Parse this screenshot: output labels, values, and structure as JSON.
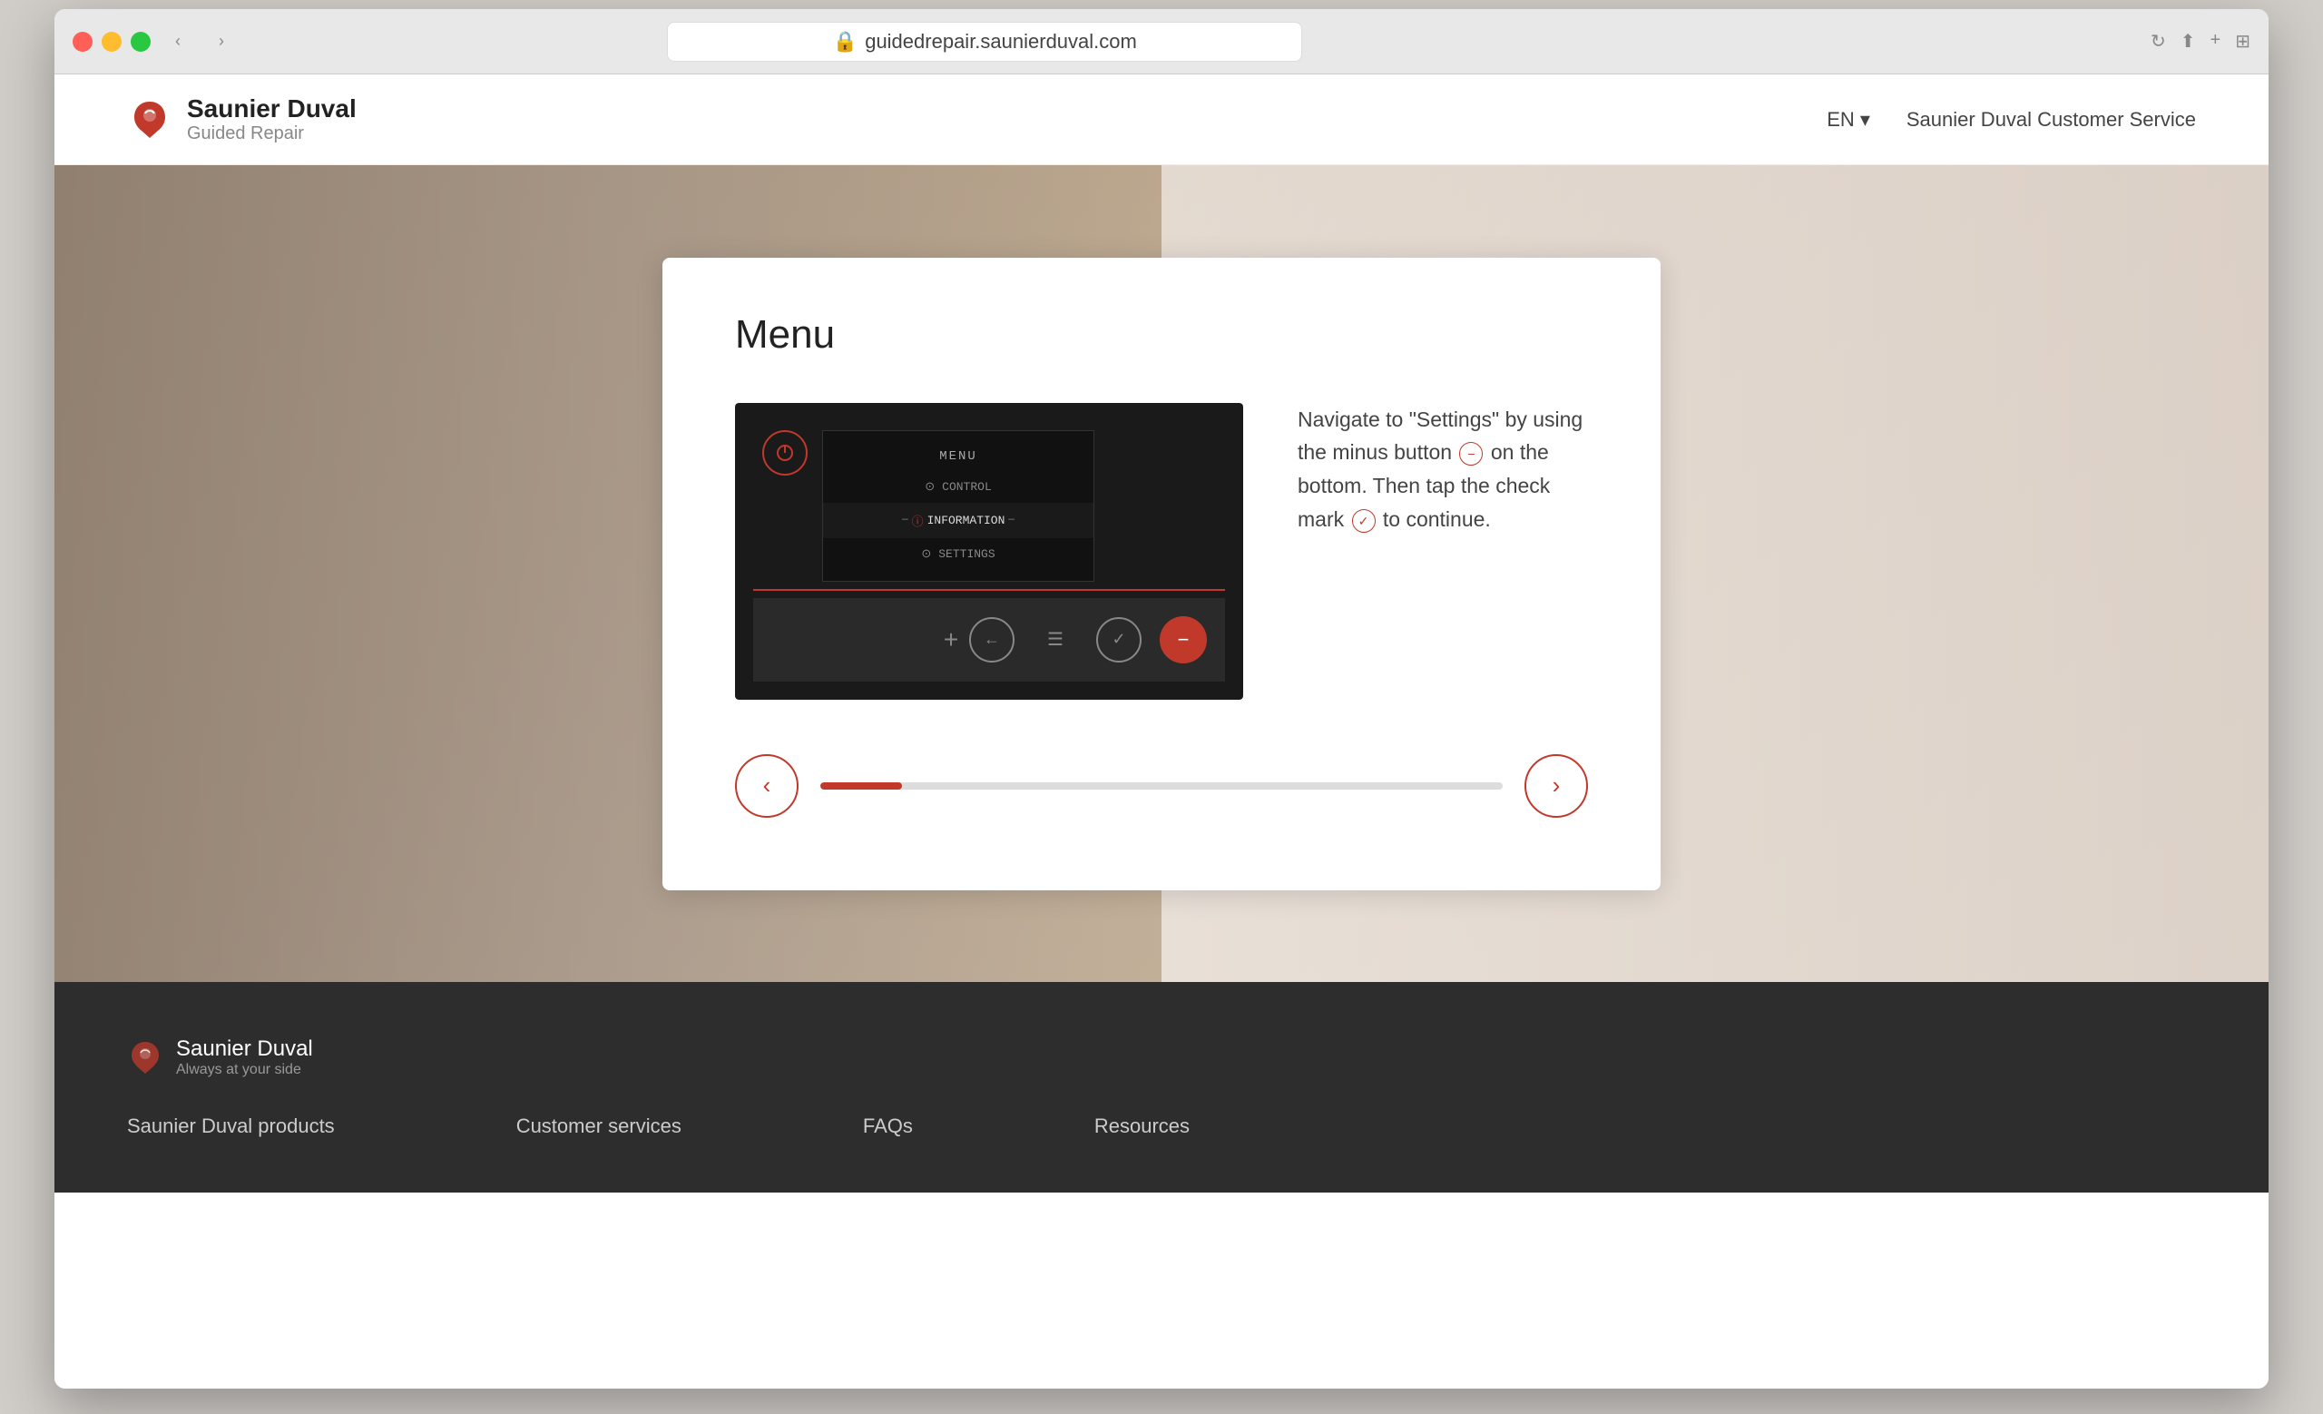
{
  "browser": {
    "url": "guidedrepair.saunierduval.com",
    "nav_back": "‹",
    "nav_forward": "›",
    "refresh": "↻",
    "share": "⬆",
    "new_tab": "+",
    "tab_grid": "⊞"
  },
  "header": {
    "logo_brand": "Saunier Duval",
    "logo_subtitle": "Guided Repair",
    "lang_label": "EN",
    "customer_service_label": "Saunier Duval Customer Service"
  },
  "card": {
    "title": "Menu",
    "description": "Navigate to \"Settings\" by using the minus button  on the bottom. Then tap the check mark  to continue.",
    "description_part1": "Navigate to \"Settings\" by using the\nminus button",
    "description_part2": "on the bottom. Then\ntap the check mark",
    "description_part3": "to continue.",
    "device": {
      "menu_title": "MENU",
      "items": [
        {
          "label": "CONTROL",
          "icon": "⊙",
          "state": "normal"
        },
        {
          "label": "INFORMATION",
          "icon": "ⓘ",
          "state": "active"
        },
        {
          "label": "SETTINGS",
          "icon": "⊙",
          "state": "normal"
        }
      ],
      "plus_btn": "+",
      "minus_btn": "−"
    },
    "progress": {
      "percent": 12
    }
  },
  "footer": {
    "logo_brand": "Saunier Duval",
    "logo_tagline": "Always at your side",
    "links": [
      {
        "label": "Saunier Duval products"
      },
      {
        "label": "Customer services"
      },
      {
        "label": "FAQs"
      },
      {
        "label": "Resources"
      }
    ]
  },
  "colors": {
    "brand_red": "#c0392b",
    "dark_bg": "#2d2d2d",
    "text_primary": "#222",
    "text_secondary": "#888"
  }
}
